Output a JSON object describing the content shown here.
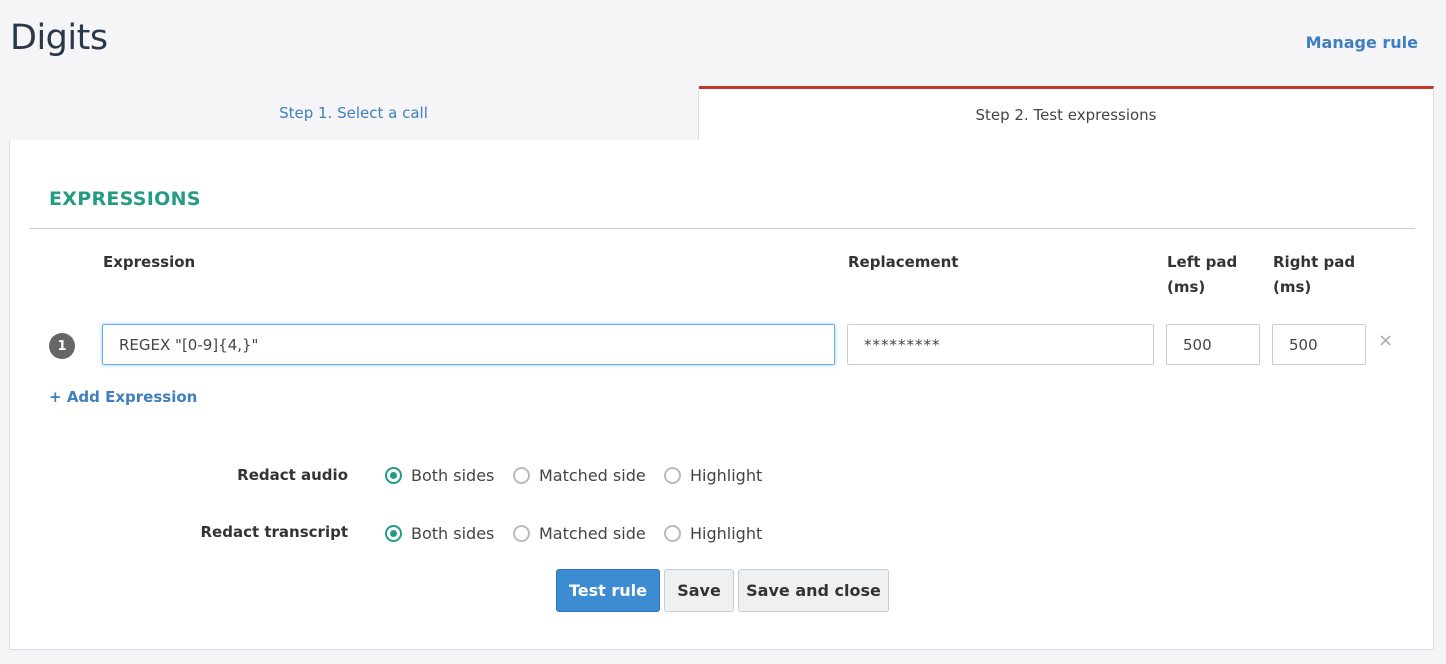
{
  "header": {
    "title": "Digits",
    "manage_link": "Manage rule"
  },
  "tabs": [
    {
      "label": "Step 1. Select a call"
    },
    {
      "label": "Step 2. Test expressions"
    }
  ],
  "expressions": {
    "section_title": "EXPRESSIONS",
    "columns": {
      "expression": "Expression",
      "replacement": "Replacement",
      "left_pad_1": "Left pad",
      "left_pad_2": "(ms)",
      "right_pad_1": "Right pad",
      "right_pad_2": "(ms)"
    },
    "rows": [
      {
        "index": "1",
        "expression": "REGEX \"[0-9]{4,}\"",
        "replacement": "*********",
        "left_pad": "500",
        "right_pad": "500",
        "remove": "×"
      }
    ],
    "add_label": "Add Expression",
    "add_icon": "+"
  },
  "redact": {
    "audio_label": "Redact audio",
    "transcript_label": "Redact transcript",
    "options": [
      "Both sides",
      "Matched side",
      "Highlight"
    ],
    "audio_selected": "Both sides",
    "transcript_selected": "Both sides"
  },
  "buttons": {
    "test": "Test rule",
    "save": "Save",
    "save_close": "Save and close"
  },
  "colors": {
    "accent": "#249c84",
    "link": "#3f7fbf",
    "tab_active": "#c0392b",
    "primary": "#3d8bd0"
  }
}
